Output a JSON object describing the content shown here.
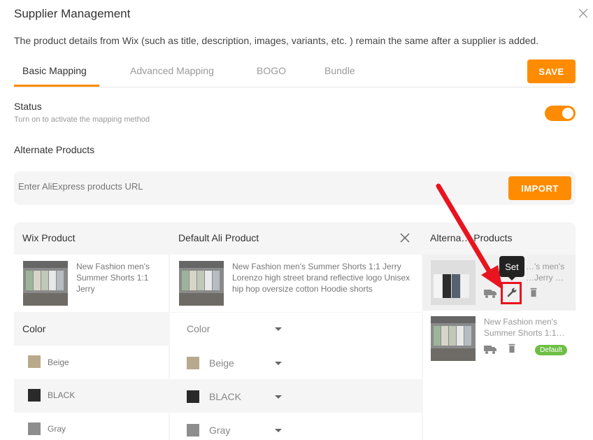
{
  "modal": {
    "title": "Supplier Management",
    "description": "The product details from Wix (such as title, description, images, variants, etc. ) remain the same after a supplier is added."
  },
  "tabs": [
    {
      "label": "Basic Mapping",
      "active": true
    },
    {
      "label": "Advanced Mapping",
      "active": false
    },
    {
      "label": "BOGO",
      "active": false
    },
    {
      "label": "Bundle",
      "active": false
    }
  ],
  "save_label": "SAVE",
  "status": {
    "title": "Status",
    "subtitle": "Turn on to activate the mapping method",
    "enabled": true
  },
  "alternate_products_title": "Alternate Products",
  "import": {
    "placeholder": "Enter AliExpress products URL",
    "button_label": "IMPORT"
  },
  "table": {
    "headers": {
      "wix": "Wix Product",
      "default_ali": "Default Ali Product",
      "alternate": "Alterna… Products"
    },
    "wix_product": {
      "title": "New Fashion men's Summer Shorts 1:1 Jerry"
    },
    "default_ali_product": {
      "title": "New Fashion men's Summer Shorts 1:1 Jerry Lorenzo high street brand reflective logo Unisex hip hop oversize cotton Hoodie shorts"
    },
    "option_label": "Color",
    "option_select": "Color",
    "variants": [
      {
        "wix": "Beige",
        "ali": "Beige",
        "swatch": "#b9a98c"
      },
      {
        "wix": "BLACK",
        "ali": "BLACK",
        "swatch": "#2a2a2a"
      },
      {
        "wix": "Gray",
        "ali": "Gray",
        "swatch": "#8d8d8d"
      }
    ],
    "alternates": [
      {
        "title": "…'s men's …Jerry …",
        "tooltip": "Set"
      },
      {
        "title": "New Fashion men's Summer Shorts 1:1…",
        "badge": "Default"
      }
    ]
  },
  "colors": {
    "accent": "#ff8c00",
    "highlight": "#e8141f",
    "badge_green": "#6fbf45"
  }
}
